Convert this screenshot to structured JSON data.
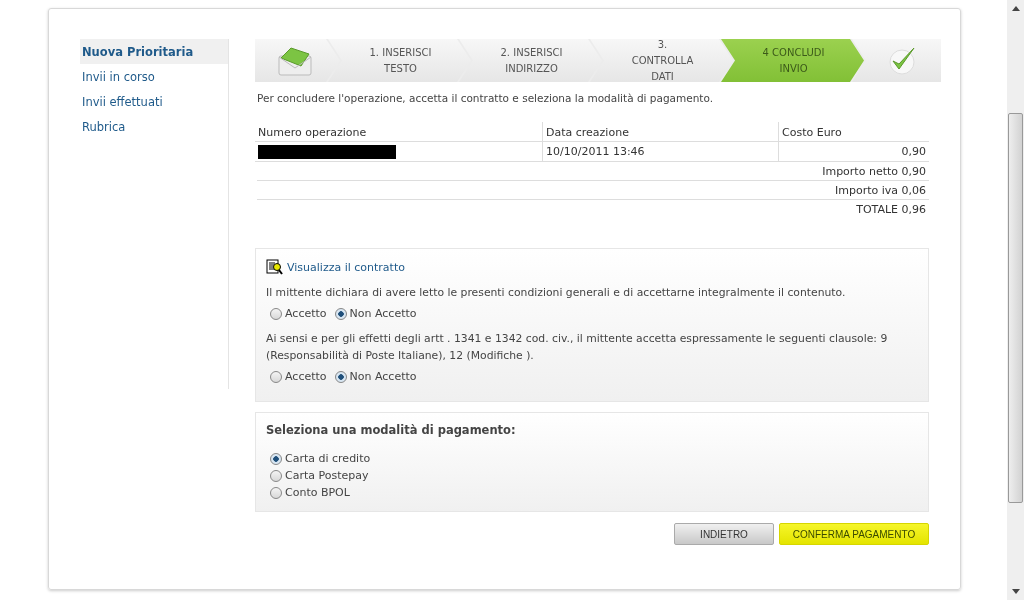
{
  "sidebar": {
    "items": [
      {
        "label": "Nuova Prioritaria",
        "selected": true
      },
      {
        "label": "Invii in corso",
        "selected": false
      },
      {
        "label": "Invii effettuati",
        "selected": false
      },
      {
        "label": "Rubrica",
        "selected": false
      }
    ]
  },
  "steps": [
    {
      "kind": "icon",
      "selected": false
    },
    {
      "kind": "text",
      "label": "1. INSERISCI TESTO",
      "selected": false
    },
    {
      "kind": "text",
      "label": "2. INSERISCI INDIRIZZO",
      "selected": false
    },
    {
      "kind": "text",
      "label": "3. CONTROLLA DATI",
      "selected": false
    },
    {
      "kind": "text",
      "label": "4 CONCLUDI INVIO",
      "selected": true
    },
    {
      "kind": "check",
      "selected": false
    }
  ],
  "instruction": "Per concludere l'operazione, accetta il contratto e seleziona la modalità di pagamento.",
  "table": {
    "columns": [
      "Numero operazione",
      "Data creazione",
      "Costo Euro"
    ],
    "rows": [
      {
        "operation_redacted": true,
        "date": "10/10/2011 13:46",
        "cost": "0,90"
      }
    ],
    "totals": [
      "Importo netto 0,90",
      "Importo iva 0,06",
      "TOTALE 0,96"
    ]
  },
  "contract": {
    "link": "Visualizza il contratto",
    "clauses": [
      {
        "text": "Il mittente dichiara di avere letto le presenti condizioni generali e di accettarne integralmente il contenuto.",
        "options": [
          {
            "label": "Accetto",
            "selected": false
          },
          {
            "label": "Non Accetto",
            "selected": true
          }
        ]
      },
      {
        "text": "Ai sensi e per gli effetti degli artt . 1341 e 1342 cod. civ., il mittente accetta espressamente le seguenti clausole: 9 (Responsabilità di Poste Italiane), 12 (Modifiche ).",
        "options": [
          {
            "label": "Accetto",
            "selected": false
          },
          {
            "label": "Non Accetto",
            "selected": true
          }
        ]
      }
    ]
  },
  "payment": {
    "title": "Seleziona una modalità di pagamento:",
    "options": [
      {
        "label": "Carta di credito",
        "selected": true
      },
      {
        "label": "Carta Postepay",
        "selected": false
      },
      {
        "label": "Conto BPOL",
        "selected": false
      }
    ]
  },
  "buttons": [
    {
      "label": "INDIETRO",
      "kind": "secondary"
    },
    {
      "label": "CONFERMA PAGAMENTO",
      "kind": "primary"
    }
  ]
}
